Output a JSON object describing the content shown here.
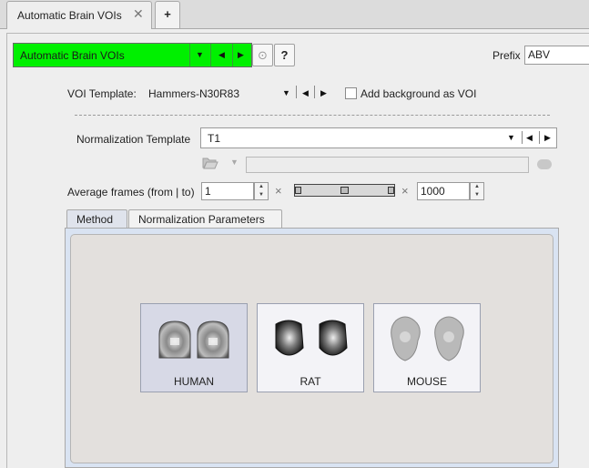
{
  "tabs": {
    "doc_tab_label": "Automatic Brain VOIs",
    "close_glyph": "✕",
    "add_label": "+"
  },
  "toolbar": {
    "protocol_value": "Automatic Brain VOIs",
    "protocol_color": "#00f000",
    "help_label": "?",
    "prefix_label": "Prefix",
    "prefix_value": "ABV"
  },
  "voi": {
    "label": "VOI Template:",
    "value": "Hammers-N30R83",
    "background_checkbox_label": "Add background as VOI",
    "background_checked": false
  },
  "normalization": {
    "label": "Normalization Template",
    "value": "T1"
  },
  "average": {
    "label": "Average frames (from | to)",
    "from": "1",
    "to": "1000",
    "separator": "×"
  },
  "method_tabs": [
    {
      "label": "Method",
      "active": true
    },
    {
      "label": "Normalization Parameters",
      "active": false
    }
  ],
  "species": [
    {
      "name": "HUMAN",
      "selected": true
    },
    {
      "name": "RAT",
      "selected": false
    },
    {
      "name": "MOUSE",
      "selected": false
    }
  ],
  "icons": {
    "combo_dropdown": "chevron-down-icon",
    "prev": "triangle-left-icon",
    "next": "triangle-right-icon",
    "target": "target-icon",
    "folder": "folder-open-icon",
    "more": "ellipsis-icon"
  }
}
